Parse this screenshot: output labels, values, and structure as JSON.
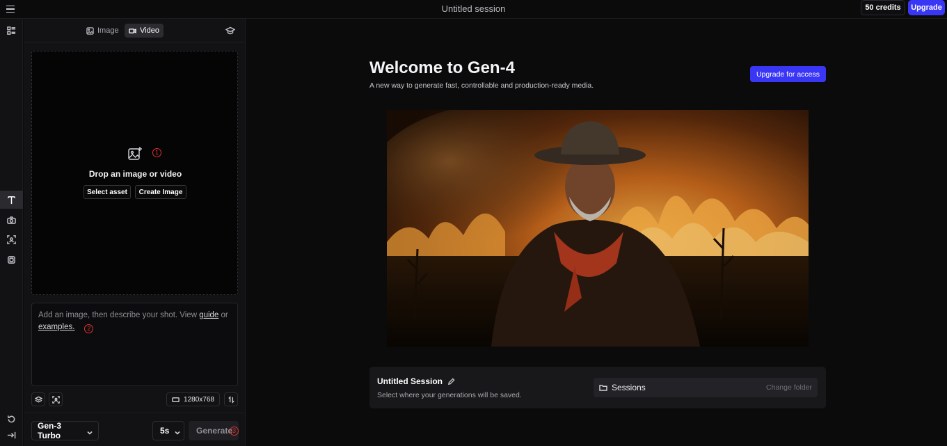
{
  "topbar": {
    "session_title": "Untitled session",
    "credits": "50 credits",
    "upgrade": "Upgrade"
  },
  "panel": {
    "tabs": [
      {
        "label": "Image",
        "icon": "image-icon"
      },
      {
        "label": "Video",
        "icon": "video-icon",
        "active": true
      }
    ],
    "dropzone": {
      "text": "Drop an image or video",
      "select_asset": "Select asset",
      "create_image": "Create Image",
      "marker": "1"
    },
    "prompt": {
      "text_before": "Add an image, then describe your shot. View ",
      "guide": "guide",
      "text_mid": " or ",
      "examples": "examples.",
      "marker": "2"
    },
    "resolution": "1280x768",
    "model": "Gen-3 Turbo",
    "duration": "5s",
    "generate": "Generate",
    "generate_marker": "3"
  },
  "main": {
    "title": "Welcome to Gen-4",
    "subtitle": "A new way to generate fast, controllable and production-ready media.",
    "access_button": "Upgrade for access"
  },
  "session_card": {
    "title": "Untitled Session",
    "subtitle": "Select where your generations will be saved.",
    "folder": "Sessions",
    "change_folder": "Change folder"
  },
  "colors": {
    "accent": "#3a36f5",
    "marker": "#e0342f",
    "background": "#0b0b0c"
  }
}
